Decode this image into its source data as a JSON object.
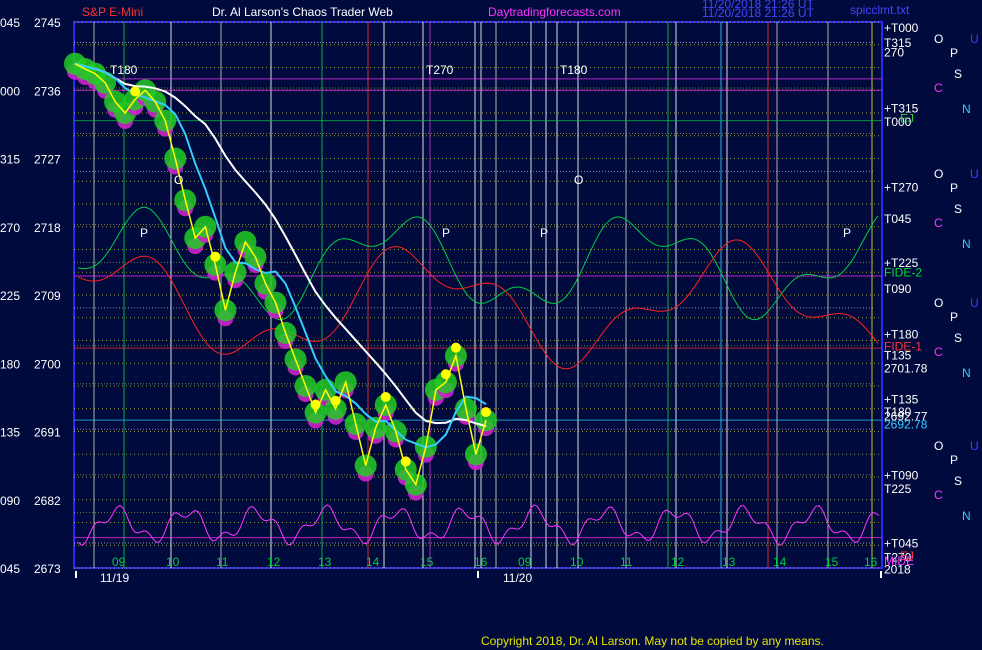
{
  "header": {
    "symbol": "S&P E-Mini",
    "title": "Dr. Al Larson's Chaos Trader Web",
    "site": "Daytradingforecasts.com",
    "stamp1": "11/20/2018 21:26 UT",
    "stamp2": "11/20/2018 21:26 UT",
    "short": "spicclmt.txt"
  },
  "copyright": "Copyright 2018, Dr. Al Larson. May not be copied by any means.",
  "colors": {
    "background": "#000a3c",
    "frame": "#2a2aff",
    "price": "#ffff00",
    "sma": "#33ccff",
    "sma_long": "#ffffff",
    "green_halo": "#22cc22",
    "magenta_halo": "#cc22cc",
    "green_osc": "#00cc44",
    "red_line": "#ff2020",
    "magenta_osc": "#ff33ff"
  },
  "chart_data": {
    "type": "line",
    "title": "S&P E-Mini",
    "y_left_outer": [
      "045",
      "000",
      "315",
      "270",
      "225",
      "180",
      "135",
      "090",
      "045"
    ],
    "y_left_prices": [
      2745,
      2736,
      2727,
      2718,
      2709,
      2700,
      2691,
      2682,
      2673
    ],
    "ylim": [
      2673,
      2745
    ],
    "x_hour_labels_day1": [
      "09",
      "10",
      "11",
      "12",
      "13",
      "14",
      "15",
      "16"
    ],
    "x_hour_labels_day2": [
      "09",
      "10",
      "11",
      "12",
      "13",
      "14",
      "15",
      "16"
    ],
    "dates": [
      "11/19",
      "11/20"
    ],
    "right_labels": [
      {
        "text": "+T000",
        "price": 2744.2,
        "color": "#ffffff"
      },
      {
        "text": "T315",
        "price": 2742.2,
        "color": "#ffffff"
      },
      {
        "text": "270",
        "price": 2741.0,
        "color": "#ffffff"
      },
      {
        "text": "+T315",
        "price": 2733.6,
        "color": "#ffffff"
      },
      {
        "text": "T000",
        "price": 2731.8,
        "color": "#ffffff"
      },
      {
        "text": "EJ",
        "price": 2732.3,
        "color": "#33cc33"
      },
      {
        "text": "+T270",
        "price": 2723.2,
        "color": "#ffffff"
      },
      {
        "text": "T045",
        "price": 2719.0,
        "color": "#ffffff"
      },
      {
        "text": "+T225",
        "price": 2713.2,
        "color": "#ffffff"
      },
      {
        "text": "FIDE-2",
        "price": 2712.0,
        "color": "#00dd33"
      },
      {
        "text": "T090",
        "price": 2709.8,
        "color": "#ffffff"
      },
      {
        "text": "+T180",
        "price": 2703.8,
        "color": "#ffffff"
      },
      {
        "text": "FIDE-1",
        "price": 2702.2,
        "color": "#ff3333"
      },
      {
        "text": "T135",
        "price": 2701.0,
        "color": "#ffffff"
      },
      {
        "text": "2701.78",
        "price": 2699.3,
        "color": "#ffffff"
      },
      {
        "text": "+T135",
        "price": 2695.2,
        "color": "#ffffff"
      },
      {
        "text": "T180",
        "price": 2693.6,
        "color": "#ffffff"
      },
      {
        "text": "2692.77",
        "price": 2693.0,
        "color": "#ffffff"
      },
      {
        "text": "2692.78",
        "price": 2691.9,
        "color": "#33ccff"
      },
      {
        "text": "+T090",
        "price": 2685.2,
        "color": "#ffffff"
      },
      {
        "text": "T225",
        "price": 2683.4,
        "color": "#ffffff"
      },
      {
        "text": "+T045",
        "price": 2676.2,
        "color": "#ffffff"
      },
      {
        "text": "T270",
        "price": 2674.4,
        "color": "#ffffff"
      },
      {
        "text": "EJ",
        "price": 2674.6,
        "color": "#ff3333"
      },
      {
        "text": "MIDE",
        "price": 2673.9,
        "color": "#ff33ff"
      },
      {
        "text": "2018",
        "price": 2672.8,
        "color": "#ffffff"
      }
    ],
    "planet_markers": [
      {
        "text": "O",
        "color": "#ffffff"
      },
      {
        "text": "U",
        "color": "#3344ff"
      },
      {
        "text": "P",
        "color": "#ffffff"
      },
      {
        "text": "S",
        "color": "#ffffff"
      },
      {
        "text": "C",
        "color": "#ff33ff"
      },
      {
        "text": "N",
        "color": "#33ccff"
      }
    ],
    "in_chart_labels": [
      {
        "text": "T180",
        "color": "#ffffff"
      },
      {
        "text": "T270",
        "color": "#ffffff"
      },
      {
        "text": "T180",
        "color": "#ffffff"
      },
      {
        "text": "P",
        "color": "#ffffff"
      },
      {
        "text": "P",
        "color": "#ffffff"
      },
      {
        "text": "P",
        "color": "#ffffff"
      },
      {
        "text": "P",
        "color": "#ffffff"
      },
      {
        "text": "O",
        "color": "#ffffff"
      },
      {
        "text": "O",
        "color": "#ffffff"
      }
    ],
    "series": [
      {
        "name": "S&P E-Mini",
        "values": [
          2739.5,
          2738.8,
          2738.2,
          2737.0,
          2734.5,
          2733.0,
          2734.8,
          2736.0,
          2734.5,
          2732.0,
          2727.0,
          2721.5,
          2716.5,
          2718.0,
          2713.0,
          2707.0,
          2712.0,
          2716.0,
          2714.0,
          2710.5,
          2708.0,
          2704.0,
          2700.5,
          2697.0,
          2693.5,
          2696.5,
          2694.0,
          2697.5,
          2692.0,
          2686.5,
          2691.5,
          2694.5,
          2691.0,
          2686.0,
          2684.0,
          2689.0,
          2696.5,
          2697.5,
          2701.0,
          2694.0,
          2688.0,
          2692.5
        ]
      }
    ]
  }
}
